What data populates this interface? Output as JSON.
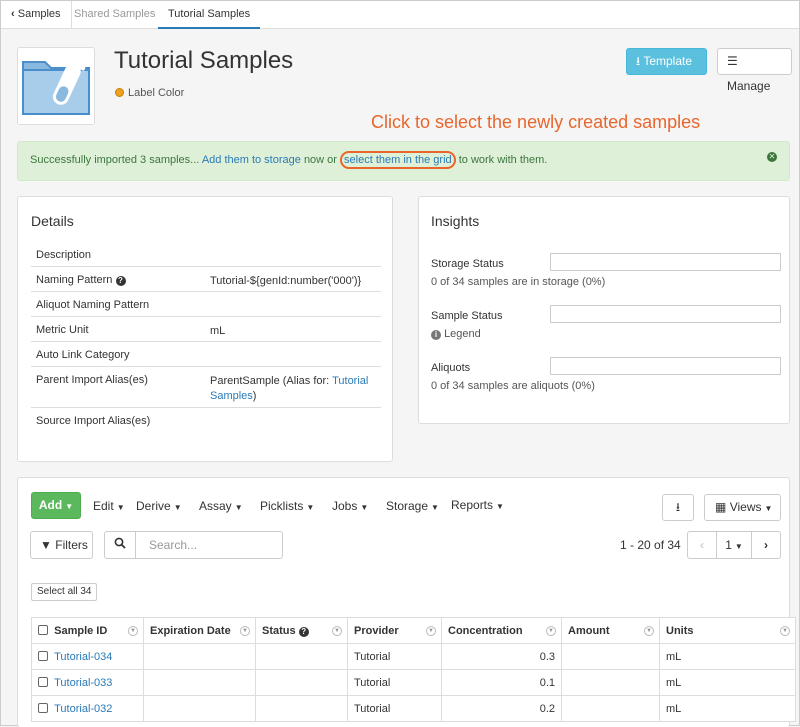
{
  "tabs": {
    "back": "Samples",
    "shared": "Shared Samples",
    "current": "Tutorial Samples"
  },
  "header": {
    "title": "Tutorial Samples",
    "label_color": "Label Color",
    "template_button": "Template",
    "manage_button": "Manage",
    "label_color_hex": "#f0a020"
  },
  "callout": "Click to select the newly created samples",
  "alert": {
    "prefix": "Successfully imported 3 samples...",
    "storage_link": "Add them to storage",
    "middle": "now or",
    "grid_link": "select them in the grid",
    "suffix": "to work with them."
  },
  "details": {
    "title": "Details",
    "rows": [
      {
        "label": "Description",
        "value": ""
      },
      {
        "label": "Naming Pattern",
        "value": "Tutorial-${genId:number('000')}"
      },
      {
        "label": "Aliquot Naming Pattern",
        "value": ""
      },
      {
        "label": "Metric Unit",
        "value": "mL"
      },
      {
        "label": "Auto Link Category",
        "value": ""
      },
      {
        "label": "Parent Import Alias(es)",
        "value_prefix": "ParentSample (Alias for:",
        "value_link": "Tutorial Samples",
        "value_suffix": ")"
      },
      {
        "label": "Source Import Alias(es)",
        "value": ""
      }
    ]
  },
  "insights": {
    "title": "Insights",
    "storage_label": "Storage Status",
    "storage_sub": "0 of 34 samples are in storage (0%)",
    "storage_fraction": 0,
    "status_label": "Sample Status",
    "legend": "Legend",
    "aliquots_label": "Aliquots",
    "aliquots_sub": "0 of 34 samples are aliquots (0%)",
    "aliquots_fraction": 0
  },
  "grid": {
    "add": "Add",
    "menus": [
      "Edit",
      "Derive",
      "Assay",
      "Picklists",
      "Jobs",
      "Storage",
      "Reports"
    ],
    "views": "Views",
    "filters": "Filters",
    "search_placeholder": "Search...",
    "paging": "1 - 20 of 34",
    "page": "1",
    "select_all": "Select all 34",
    "columns": [
      "Sample ID",
      "Expiration Date",
      "Status",
      "Provider",
      "Concentration",
      "Amount",
      "Units"
    ],
    "rows": [
      {
        "id": "Tutorial-034",
        "expiration": "",
        "status": "",
        "provider": "Tutorial",
        "concentration": "0.3",
        "amount": "",
        "units": "mL"
      },
      {
        "id": "Tutorial-033",
        "expiration": "",
        "status": "",
        "provider": "Tutorial",
        "concentration": "0.1",
        "amount": "",
        "units": "mL"
      },
      {
        "id": "Tutorial-032",
        "expiration": "",
        "status": "",
        "provider": "Tutorial",
        "concentration": "0.2",
        "amount": "",
        "units": "mL"
      }
    ]
  }
}
